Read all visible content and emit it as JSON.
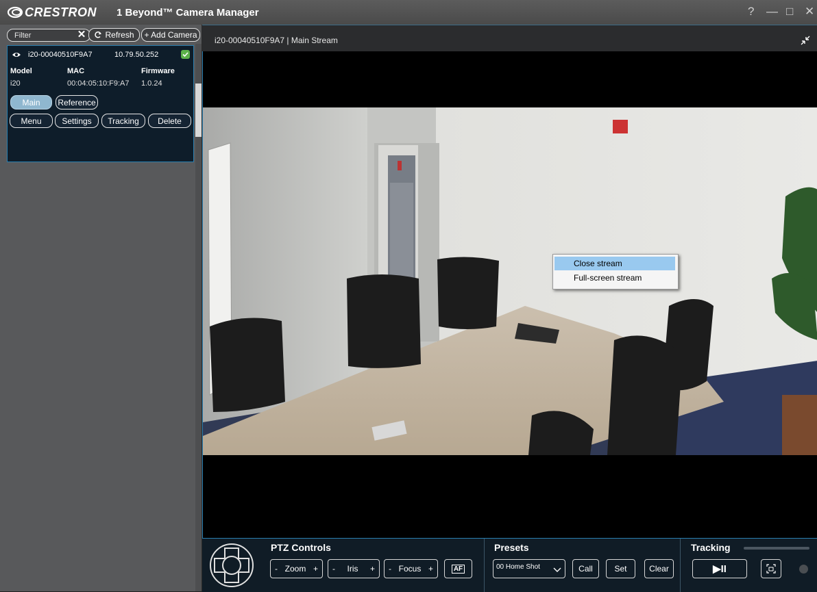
{
  "titlebar": {
    "brand": "CRESTRON",
    "app_title": "1 Beyond™ Camera Manager",
    "help_label": "?",
    "minimize_label": "—",
    "maximize_label": "□",
    "close_label": "✕"
  },
  "sidebar": {
    "filter_placeholder": "Filter",
    "clear_label": "✕",
    "refresh_label": "Refresh",
    "add_camera_label": "+ Add Camera",
    "camera": {
      "name": "i20-00040510F9A7",
      "ip": "10.79.50.252",
      "status": "connected",
      "headers": {
        "model": "Model",
        "mac": "MAC",
        "firmware": "Firmware"
      },
      "model": "i20",
      "mac": "00:04:05:10:F9:A7",
      "firmware": "1.0.24",
      "buttons": {
        "main": "Main",
        "reference": "Reference",
        "menu": "Menu",
        "settings": "Settings",
        "tracking": "Tracking",
        "delete": "Delete"
      }
    }
  },
  "stream": {
    "title": "i20-00040510F9A7 | Main Stream"
  },
  "context_menu": {
    "items": [
      "Close stream",
      "Full-screen stream"
    ],
    "highlighted": "Close stream"
  },
  "controls": {
    "ptz": {
      "title": "PTZ Controls",
      "zoom": {
        "minus": "-",
        "label": "Zoom",
        "plus": "+"
      },
      "iris": {
        "minus": "-",
        "label": "Iris",
        "plus": "+"
      },
      "focus": {
        "minus": "-",
        "label": "Focus",
        "plus": "+"
      },
      "autofocus_label": "AF"
    },
    "presets": {
      "title": "Presets",
      "selected": "00 Home Shot",
      "call_label": "Call",
      "set_label": "Set",
      "clear_label": "Clear"
    },
    "tracking": {
      "title": "Tracking",
      "play_pause_label": "▶II"
    }
  },
  "colors": {
    "accent": "#2a7fb0",
    "highlight": "#99c9ef",
    "status_ok": "#5bb14a"
  }
}
